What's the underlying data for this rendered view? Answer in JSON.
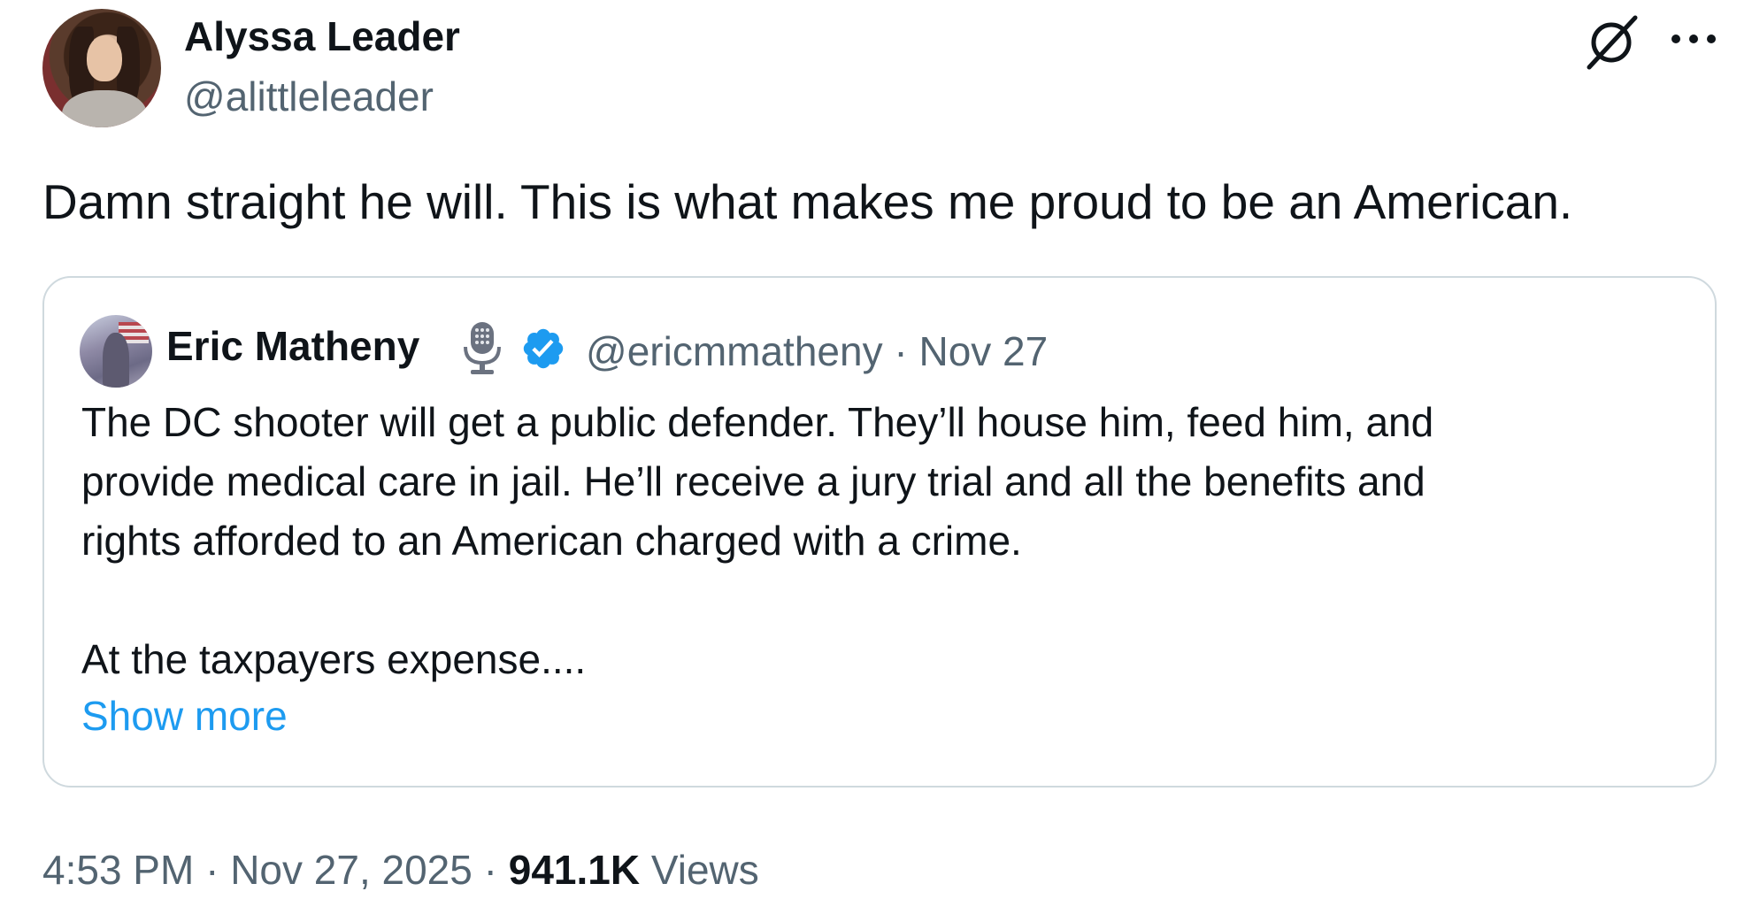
{
  "author": {
    "name": "Alyssa Leader",
    "handle": "@alittleleader"
  },
  "tweet": {
    "text": "Damn straight he will. This is what makes me proud to be an American."
  },
  "quoted_tweet": {
    "name": "Eric Matheny",
    "handle": "@ericmmatheny",
    "separator": "·",
    "date": "Nov 27",
    "body_lines": [
      "The DC shooter will get a public defender. They’ll house him, feed him, and",
      "provide medical care in jail. He’ll receive a jury trial and all the benefits and",
      "rights afforded to an American charged with a crime.",
      "At the taxpayers expense...."
    ],
    "show_more_label": "Show more",
    "icons": [
      "microphone-icon",
      "verified-badge-icon"
    ],
    "verified_color": "#1d9bf0"
  },
  "footer": {
    "time": "4:53 PM",
    "separator": "·",
    "date": "Nov 27, 2025",
    "views_count": "941.1K",
    "views_label": "Views"
  },
  "header_icons": [
    "grok-icon",
    "more-options-icon"
  ],
  "colors": {
    "text_primary": "#0f1419",
    "text_secondary": "#536471",
    "link": "#1d9bf0",
    "border": "#cfd9de"
  }
}
